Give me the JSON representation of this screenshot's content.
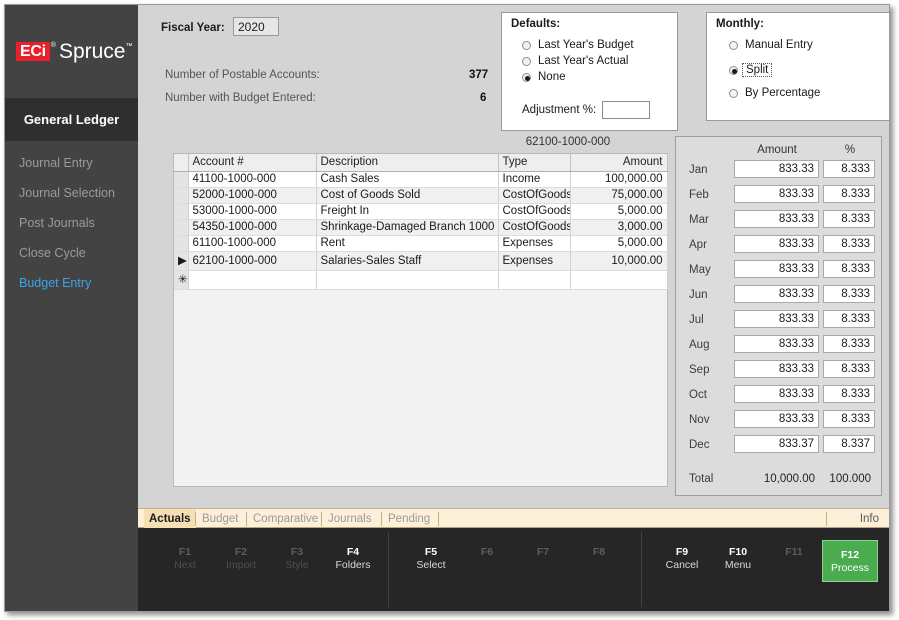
{
  "brand": {
    "logo_box": "ECi",
    "logo_text": "Spruce",
    "registered_mark": "®",
    "trademark": "™"
  },
  "sidebar": {
    "module_title": "General Ledger",
    "items": [
      {
        "label": "Journal Entry",
        "active": false
      },
      {
        "label": "Journal Selection",
        "active": false
      },
      {
        "label": "Post Journals",
        "active": false
      },
      {
        "label": "Close Cycle",
        "active": false
      },
      {
        "label": "Budget Entry",
        "active": true
      }
    ]
  },
  "header": {
    "fiscal_year_label": "Fiscal Year:",
    "fiscal_year_value": "2020",
    "postable_accounts_label": "Number of Postable Accounts:",
    "postable_accounts_value": "377",
    "budget_entered_label": "Number with Budget Entered:",
    "budget_entered_value": "6"
  },
  "defaults_group": {
    "title": "Defaults:",
    "options": [
      {
        "label": "Last Year's Budget",
        "checked": false
      },
      {
        "label": "Last Year's Actual",
        "checked": false
      },
      {
        "label": "None",
        "checked": true
      }
    ],
    "adjustment_label": "Adjustment %:",
    "adjustment_value": ""
  },
  "monthly_group": {
    "title": "Monthly:",
    "options": [
      {
        "label": "Manual Entry",
        "checked": false,
        "focused": false
      },
      {
        "label": "Split",
        "checked": true,
        "focused": true
      },
      {
        "label": "By Percentage",
        "checked": false,
        "focused": false
      }
    ]
  },
  "grid": {
    "selected_account_caption": "62100-1000-000",
    "columns": [
      "Account #",
      "Description",
      "Type",
      "Amount"
    ],
    "rows": [
      {
        "marker": "",
        "account": "41100-1000-000",
        "description": "Cash Sales",
        "type": "Income",
        "amount": "100,000.00"
      },
      {
        "marker": "",
        "account": "52000-1000-000",
        "description": "Cost of Goods Sold",
        "type": "CostOfGoods",
        "amount": "75,000.00"
      },
      {
        "marker": "",
        "account": "53000-1000-000",
        "description": "Freight In",
        "type": "CostOfGoods",
        "amount": "5,000.00"
      },
      {
        "marker": "",
        "account": "54350-1000-000",
        "description": "Shrinkage-Damaged Branch 1000",
        "type": "CostOfGoods",
        "amount": "3,000.00"
      },
      {
        "marker": "",
        "account": "61100-1000-000",
        "description": "Rent",
        "type": "Expenses",
        "amount": "5,000.00"
      },
      {
        "marker": "▶",
        "account": "62100-1000-000",
        "description": "Salaries-Sales Staff",
        "type": "Expenses",
        "amount": "10,000.00"
      },
      {
        "marker": "✳",
        "account": "",
        "description": "",
        "type": "",
        "amount": ""
      }
    ]
  },
  "months_panel": {
    "amount_header": "Amount",
    "percent_header": "%",
    "rows": [
      {
        "month": "Jan",
        "amount": "833.33",
        "percent": "8.333"
      },
      {
        "month": "Feb",
        "amount": "833.33",
        "percent": "8.333"
      },
      {
        "month": "Mar",
        "amount": "833.33",
        "percent": "8.333"
      },
      {
        "month": "Apr",
        "amount": "833.33",
        "percent": "8.333"
      },
      {
        "month": "May",
        "amount": "833.33",
        "percent": "8.333"
      },
      {
        "month": "Jun",
        "amount": "833.33",
        "percent": "8.333"
      },
      {
        "month": "Jul",
        "amount": "833.33",
        "percent": "8.333"
      },
      {
        "month": "Aug",
        "amount": "833.33",
        "percent": "8.333"
      },
      {
        "month": "Sep",
        "amount": "833.33",
        "percent": "8.333"
      },
      {
        "month": "Oct",
        "amount": "833.33",
        "percent": "8.333"
      },
      {
        "month": "Nov",
        "amount": "833.33",
        "percent": "8.333"
      },
      {
        "month": "Dec",
        "amount": "833.37",
        "percent": "8.337"
      }
    ],
    "total_label": "Total",
    "total_amount": "10,000.00",
    "total_percent": "100.000"
  },
  "tabs": {
    "items": [
      {
        "label": "Actuals",
        "active": true
      },
      {
        "label": "Budget",
        "active": false
      },
      {
        "label": "Comparative",
        "active": false
      },
      {
        "label": "Journals",
        "active": false
      },
      {
        "label": "Pending",
        "active": false
      }
    ],
    "info_label": "Info"
  },
  "function_keys": [
    {
      "key": "F1",
      "label": "Next",
      "state": "dim"
    },
    {
      "key": "F2",
      "label": "Import",
      "state": "dim"
    },
    {
      "key": "F3",
      "label": "Style",
      "state": "dim"
    },
    {
      "key": "F4",
      "label": "Folders",
      "state": "enabled"
    },
    {
      "key": "F5",
      "label": "Select",
      "state": "enabled"
    },
    {
      "key": "F6",
      "label": "",
      "state": "dim"
    },
    {
      "key": "F7",
      "label": "",
      "state": "dim"
    },
    {
      "key": "F8",
      "label": "",
      "state": "dim"
    },
    {
      "key": "F9",
      "label": "Cancel",
      "state": "enabled"
    },
    {
      "key": "F10",
      "label": "Menu",
      "state": "enabled"
    },
    {
      "key": "F11",
      "label": "",
      "state": "dim"
    },
    {
      "key": "F12",
      "label": "Process",
      "state": "process"
    }
  ],
  "colors": {
    "sidebar_bg": "#434343",
    "module_bg": "#2f2f2f",
    "accent_blue": "#3aa5e5",
    "brand_red": "#e8202a",
    "process_green": "#4aac4f",
    "tabstrip_bg": "#fdf0d8",
    "fnbar_bg": "#262626"
  }
}
